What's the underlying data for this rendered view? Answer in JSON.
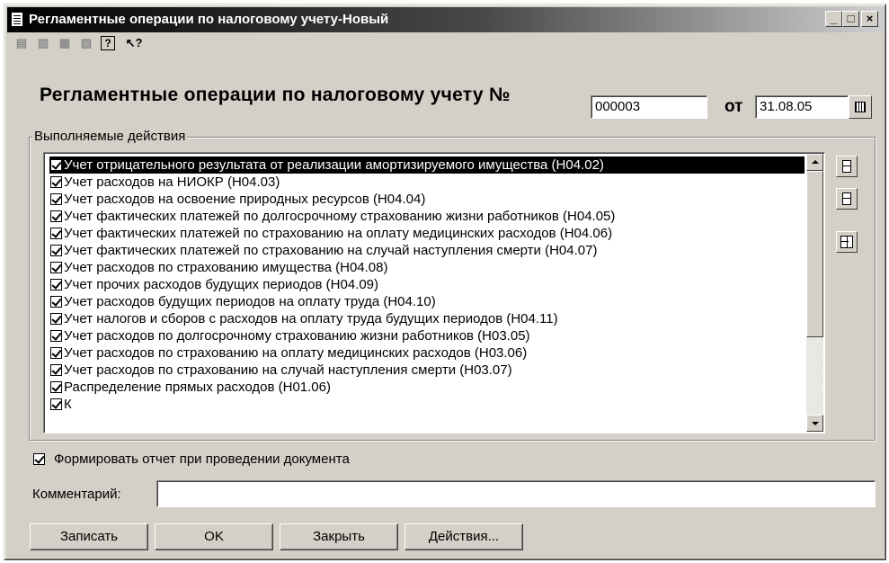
{
  "window": {
    "title": "Регламентные операции по налоговому учету-Новый",
    "controls": {
      "minimize": "_",
      "maximize": "□",
      "close": "×"
    }
  },
  "toolbar": {
    "icons": [
      "new-doc-icon",
      "copy-doc-icon",
      "edit-doc-icon",
      "delete-doc-icon",
      "help-icon",
      "whats-this-icon"
    ],
    "help_glyph": "?",
    "pointer_glyph": "↖?"
  },
  "header": {
    "title": "Регламентные операции по налоговому учету №",
    "number": "000003",
    "date_label": "от",
    "date": "31.08.05"
  },
  "actions_group": {
    "label": "Выполняемые действия",
    "items": [
      {
        "label": "Учет отрицательного результата от реализации амортизируемого имущества (Н04.02)",
        "checked": true,
        "selected": true
      },
      {
        "label": "Учет расходов на НИОКР (Н04.03)",
        "checked": true
      },
      {
        "label": "Учет расходов на освоение природных ресурсов (Н04.04)",
        "checked": true
      },
      {
        "label": "Учет фактических платежей по долгосрочному страхованию жизни работников (Н04.05)",
        "checked": true
      },
      {
        "label": "Учет фактических платежей по страхованию на оплату медицинских расходов (Н04.06)",
        "checked": true
      },
      {
        "label": "Учет фактических платежей по страхованию на случай наступления смерти (Н04.07)",
        "checked": true
      },
      {
        "label": "Учет расходов по страхованию имущества (Н04.08)",
        "checked": true
      },
      {
        "label": "Учет прочих расходов будущих периодов (Н04.09)",
        "checked": true
      },
      {
        "label": "Учет расходов будущих периодов на оплату труда (Н04.10)",
        "checked": true
      },
      {
        "label": "Учет налогов и сборов с расходов на оплату труда  будущих периодов (Н04.11)",
        "checked": true
      },
      {
        "label": "Учет расходов по долгосрочному страхованию жизни работников (Н03.05)",
        "checked": true
      },
      {
        "label": "Учет расходов по страхованию на оплату медицинских расходов (Н03.06)",
        "checked": true
      },
      {
        "label": "Учет расходов по страхованию на случай наступления смерти (Н03.07)",
        "checked": true
      },
      {
        "label": "Распределение прямых расходов (Н01.06)",
        "checked": true
      },
      {
        "label": "К",
        "checked": true
      }
    ]
  },
  "report_checkbox": {
    "label": "Формировать отчет при проведении документа",
    "checked": true
  },
  "comment": {
    "label": "Комментарий:",
    "value": ""
  },
  "buttons": {
    "save": "Записать",
    "ok": "OK",
    "close": "Закрыть",
    "actions": "Действия..."
  }
}
